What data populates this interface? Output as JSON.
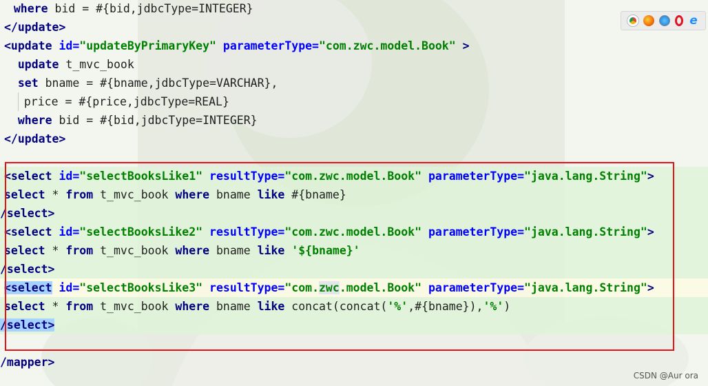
{
  "browser_icons": [
    "chrome-icon",
    "firefox-icon",
    "safari-icon",
    "opera-icon",
    "ie-icon"
  ],
  "colors": {
    "tag": "#000080",
    "attribute": "#0000ff",
    "string": "#008000",
    "highlight_box": "#e51414",
    "selection": "#a6d2ff"
  },
  "lines": [
    {
      "parts": [
        {
          "t": "  "
        },
        {
          "t": "where",
          "c": "kw"
        },
        {
          "t": " bid = #{bid,jdbcType=INTEGER}"
        }
      ]
    },
    {
      "parts": [
        {
          "t": "</update>",
          "c": "tg"
        }
      ]
    },
    {
      "parts": [
        {
          "t": "<update ",
          "c": "tg"
        },
        {
          "t": "id=",
          "c": "at"
        },
        {
          "t": "\"updateByPrimaryKey\"",
          "c": "st"
        },
        {
          "t": " parameterType=",
          "c": "at"
        },
        {
          "t": "\"com.zwc.model.Book\"",
          "c": "st"
        },
        {
          "t": " >",
          "c": "tg"
        }
      ]
    },
    {
      "parts": [
        {
          "t": "  "
        },
        {
          "t": "update",
          "c": "kw"
        },
        {
          "t": " t_mvc_book"
        }
      ]
    },
    {
      "parts": [
        {
          "t": "  "
        },
        {
          "t": "set",
          "c": "kw"
        },
        {
          "t": " bname = #{bname,jdbcType=VARCHAR},"
        }
      ]
    },
    {
      "parts": [
        {
          "t": "  "
        },
        {
          "t": "",
          "bar": true
        },
        {
          "t": "price = #{price,jdbcType=REAL}"
        }
      ]
    },
    {
      "parts": [
        {
          "t": "  "
        },
        {
          "t": "where",
          "c": "kw"
        },
        {
          "t": " bid = #{bid,jdbcType=INTEGER}"
        }
      ]
    },
    {
      "parts": [
        {
          "t": "</update>",
          "c": "tg"
        }
      ]
    },
    {
      "parts": []
    },
    {
      "parts": [
        {
          "t": "<select ",
          "c": "tg"
        },
        {
          "t": "id=",
          "c": "at"
        },
        {
          "t": "\"selectBooksLike1\"",
          "c": "st"
        },
        {
          "t": " resultType=",
          "c": "at"
        },
        {
          "t": "\"com.zwc.model.Book\"",
          "c": "st"
        },
        {
          "t": " parameterType=",
          "c": "at"
        },
        {
          "t": "\"java.lang.String\"",
          "c": "st"
        },
        {
          "t": ">",
          "c": "tg"
        }
      ]
    },
    {
      "parts": [
        {
          "t": "select",
          "c": "kw"
        },
        {
          "t": " * "
        },
        {
          "t": "from",
          "c": "kw"
        },
        {
          "t": " t_mvc_book "
        },
        {
          "t": "where",
          "c": "kw"
        },
        {
          "t": " bname "
        },
        {
          "t": "like",
          "c": "kw"
        },
        {
          "t": " #{bname}"
        }
      ]
    },
    {
      "parts": [
        {
          "t": "/select>",
          "c": "tg"
        }
      ]
    },
    {
      "parts": [
        {
          "t": "<select ",
          "c": "tg"
        },
        {
          "t": "id=",
          "c": "at"
        },
        {
          "t": "\"selectBooksLike2\"",
          "c": "st"
        },
        {
          "t": " resultType=",
          "c": "at"
        },
        {
          "t": "\"com.zwc.model.Book\"",
          "c": "st"
        },
        {
          "t": " parameterType=",
          "c": "at"
        },
        {
          "t": "\"java.lang.String\"",
          "c": "st"
        },
        {
          "t": ">",
          "c": "tg"
        }
      ]
    },
    {
      "parts": [
        {
          "t": "select",
          "c": "kw"
        },
        {
          "t": " * "
        },
        {
          "t": "from",
          "c": "kw"
        },
        {
          "t": " t_mvc_book "
        },
        {
          "t": "where",
          "c": "kw"
        },
        {
          "t": " bname "
        },
        {
          "t": "like",
          "c": "kw"
        },
        {
          "t": " "
        },
        {
          "t": "'${bname}'",
          "c": "st"
        }
      ]
    },
    {
      "parts": [
        {
          "t": "/select>",
          "c": "tg"
        }
      ]
    },
    {
      "parts": [
        {
          "t": "<select",
          "c": "tg",
          "h": "sel"
        },
        {
          "t": " ",
          "c": "tg"
        },
        {
          "t": "id=",
          "c": "at"
        },
        {
          "t": "\"selectBooksLike3\"",
          "c": "st"
        },
        {
          "t": " resultType=",
          "c": "at"
        },
        {
          "t": "\"com.",
          "c": "st"
        },
        {
          "t": "zwc",
          "c": "st",
          "h": "match"
        },
        {
          "t": ".model.Book\"",
          "c": "st"
        },
        {
          "t": " parameterType=",
          "c": "at"
        },
        {
          "t": "\"java.lang.String\"",
          "c": "st"
        },
        {
          "t": ">",
          "c": "tg"
        }
      ]
    },
    {
      "parts": [
        {
          "t": "select",
          "c": "kw"
        },
        {
          "t": " * "
        },
        {
          "t": "from",
          "c": "kw"
        },
        {
          "t": " t_mvc_book "
        },
        {
          "t": "where",
          "c": "kw"
        },
        {
          "t": " bname "
        },
        {
          "t": "like",
          "c": "kw"
        },
        {
          "t": " concat(concat("
        },
        {
          "t": "'%'",
          "c": "st"
        },
        {
          "t": ",#{bname}),"
        },
        {
          "t": "'%'",
          "c": "st"
        },
        {
          "t": ")"
        }
      ]
    },
    {
      "parts": [
        {
          "t": "/select>",
          "c": "tg",
          "h": "sel"
        }
      ]
    },
    {
      "parts": []
    },
    {
      "parts": [
        {
          "t": "/mapper>",
          "c": "tg"
        }
      ]
    }
  ],
  "watermark": "CSDN @Aur ora"
}
